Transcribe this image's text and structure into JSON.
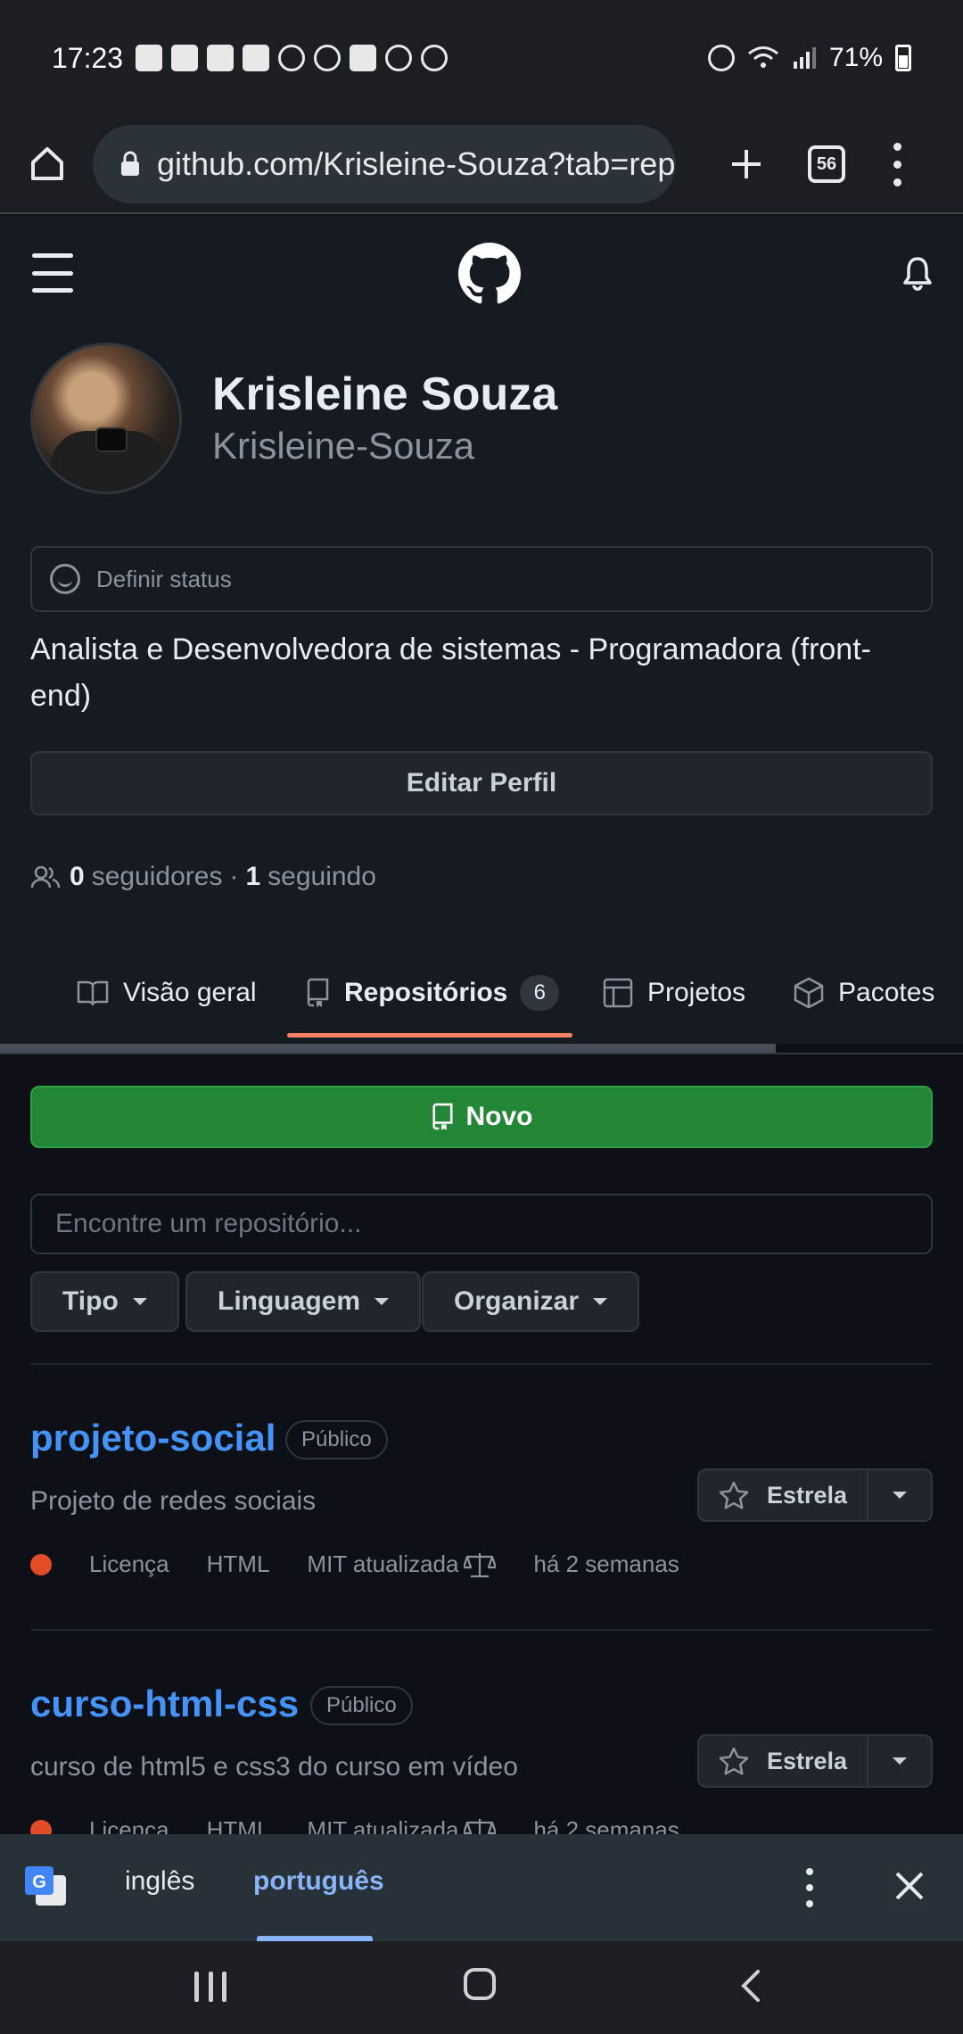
{
  "status_bar": {
    "time": "17:23",
    "battery": "71%",
    "notification_icons": [
      "facebook-icon",
      "amazon-icon",
      "mail-icon",
      "facebook-icon",
      "instagram-icon",
      "ifood-icon",
      "fingerprint-icon",
      "gallery-icon",
      "fingerprint-icon",
      "face-icon"
    ]
  },
  "browser": {
    "url": "github.com/Krisleine-Souza?tab=rep",
    "tab_count": "56"
  },
  "profile": {
    "name": "Krisleine Souza",
    "login": "Krisleine-Souza",
    "status_placeholder": "Definir status",
    "bio": "Analista e Desenvolvedora de sistemas - Programadora (front-end)",
    "edit_button": "Editar Perfil",
    "followers_count": "0",
    "followers_label": "seguidores",
    "separator": "·",
    "following_count": "1",
    "following_label": "seguindo"
  },
  "tabs": [
    {
      "label": "Visão geral",
      "icon": "book-icon"
    },
    {
      "label": "Repositórios",
      "icon": "repo-icon",
      "counter": "6",
      "active": true
    },
    {
      "label": "Projetos",
      "icon": "table-icon"
    },
    {
      "label": "Pacotes",
      "icon": "package-icon"
    }
  ],
  "repos_toolbar": {
    "new_button": "Novo",
    "search_placeholder": "Encontre um repositório...",
    "filters": [
      "Tipo",
      "Linguagem",
      "Organizar"
    ]
  },
  "repos": [
    {
      "name": "projeto-social",
      "visibility": "Público",
      "description": "Projeto de redes sociais",
      "license_label": "Licença",
      "language": "HTML",
      "license_updated": "MIT atualizada",
      "updated": "há 2 semanas",
      "star_label": "Estrela"
    },
    {
      "name": "curso-html-css",
      "visibility": "Público",
      "description": "curso de html5 e css3 do curso em vídeo",
      "license_label": "Licença",
      "language": "HTML",
      "license_updated": "MIT atualizada",
      "updated": "há 2 semanas",
      "star_label": "Estrela"
    }
  ],
  "translate_bar": {
    "source_lang": "inglês",
    "target_lang": "português"
  },
  "colors": {
    "accent_green": "#238636",
    "link_blue": "#4493f8",
    "tab_underline": "#f78166",
    "html_language": "#e34c26",
    "translate_active": "#8ab4f8"
  }
}
